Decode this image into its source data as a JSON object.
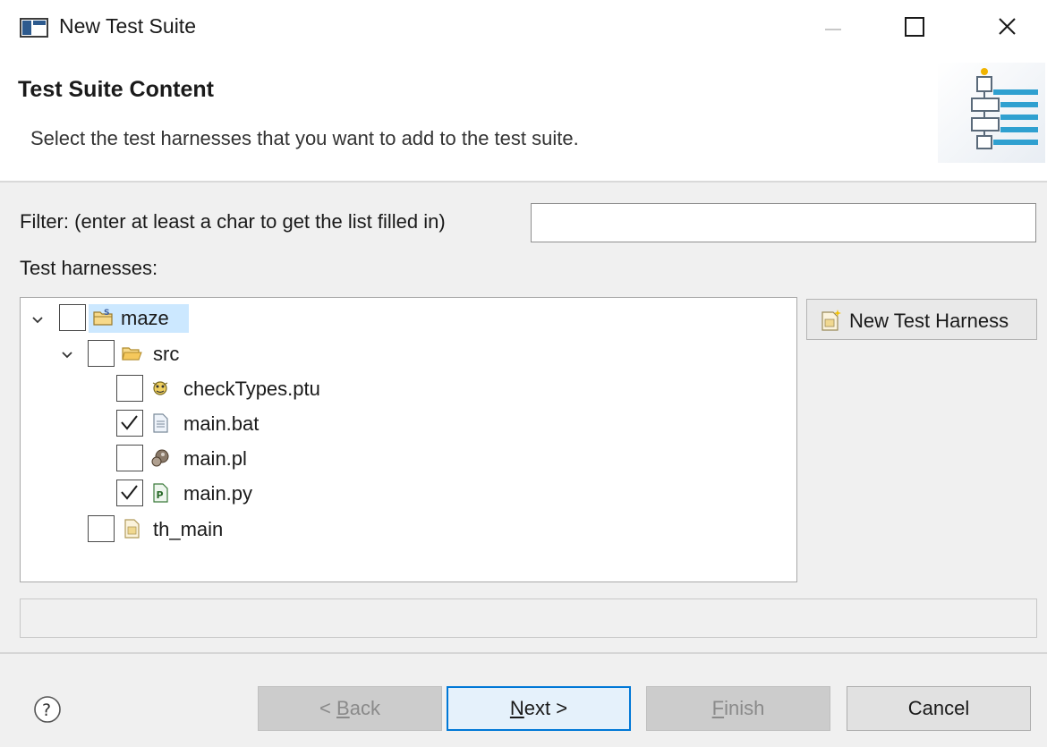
{
  "window": {
    "title": "New Test Suite",
    "icon": "eclipse-window-icon",
    "controls": [
      "minimize-icon",
      "maximize-icon",
      "close-icon"
    ]
  },
  "banner": {
    "title": "Test Suite Content",
    "description": "Select the test harnesses that you want to add to the test suite.",
    "art_icon": "test-suite-banner-icon"
  },
  "filter": {
    "label": "Filter: (enter at least a char to get the list filled in)",
    "value": "",
    "placeholder": ""
  },
  "harnesses": {
    "label": "Test harnesses:",
    "tree": [
      {
        "label": "maze",
        "expanded": true,
        "checked": false,
        "selected": true,
        "icon": "project-folder-icon"
      },
      {
        "label": "src",
        "expanded": true,
        "checked": false,
        "selected": false,
        "icon": "folder-icon"
      },
      {
        "label": "checkTypes.ptu",
        "checked": false,
        "icon": "ptu-file-icon"
      },
      {
        "label": "main.bat",
        "checked": true,
        "icon": "bat-file-icon"
      },
      {
        "label": "main.pl",
        "checked": false,
        "icon": "perl-file-icon"
      },
      {
        "label": "main.py",
        "checked": true,
        "icon": "python-file-icon"
      },
      {
        "label": "th_main",
        "checked": false,
        "icon": "harness-file-icon"
      }
    ]
  },
  "new_harness_button": {
    "label": "New Test Harness",
    "icon": "new-harness-icon"
  },
  "footer": {
    "help_icon": "help-icon",
    "back_pre": "< ",
    "back_mnemonic": "B",
    "back_post": "ack",
    "next_mnemonic": "N",
    "next_post": "ext >",
    "finish_mnemonic": "F",
    "finish_post": "inish",
    "cancel_label": "Cancel"
  },
  "colors": {
    "selection": "#cce8ff",
    "default_button_border": "#0078d7",
    "dialog_background": "#f0f0f0"
  }
}
